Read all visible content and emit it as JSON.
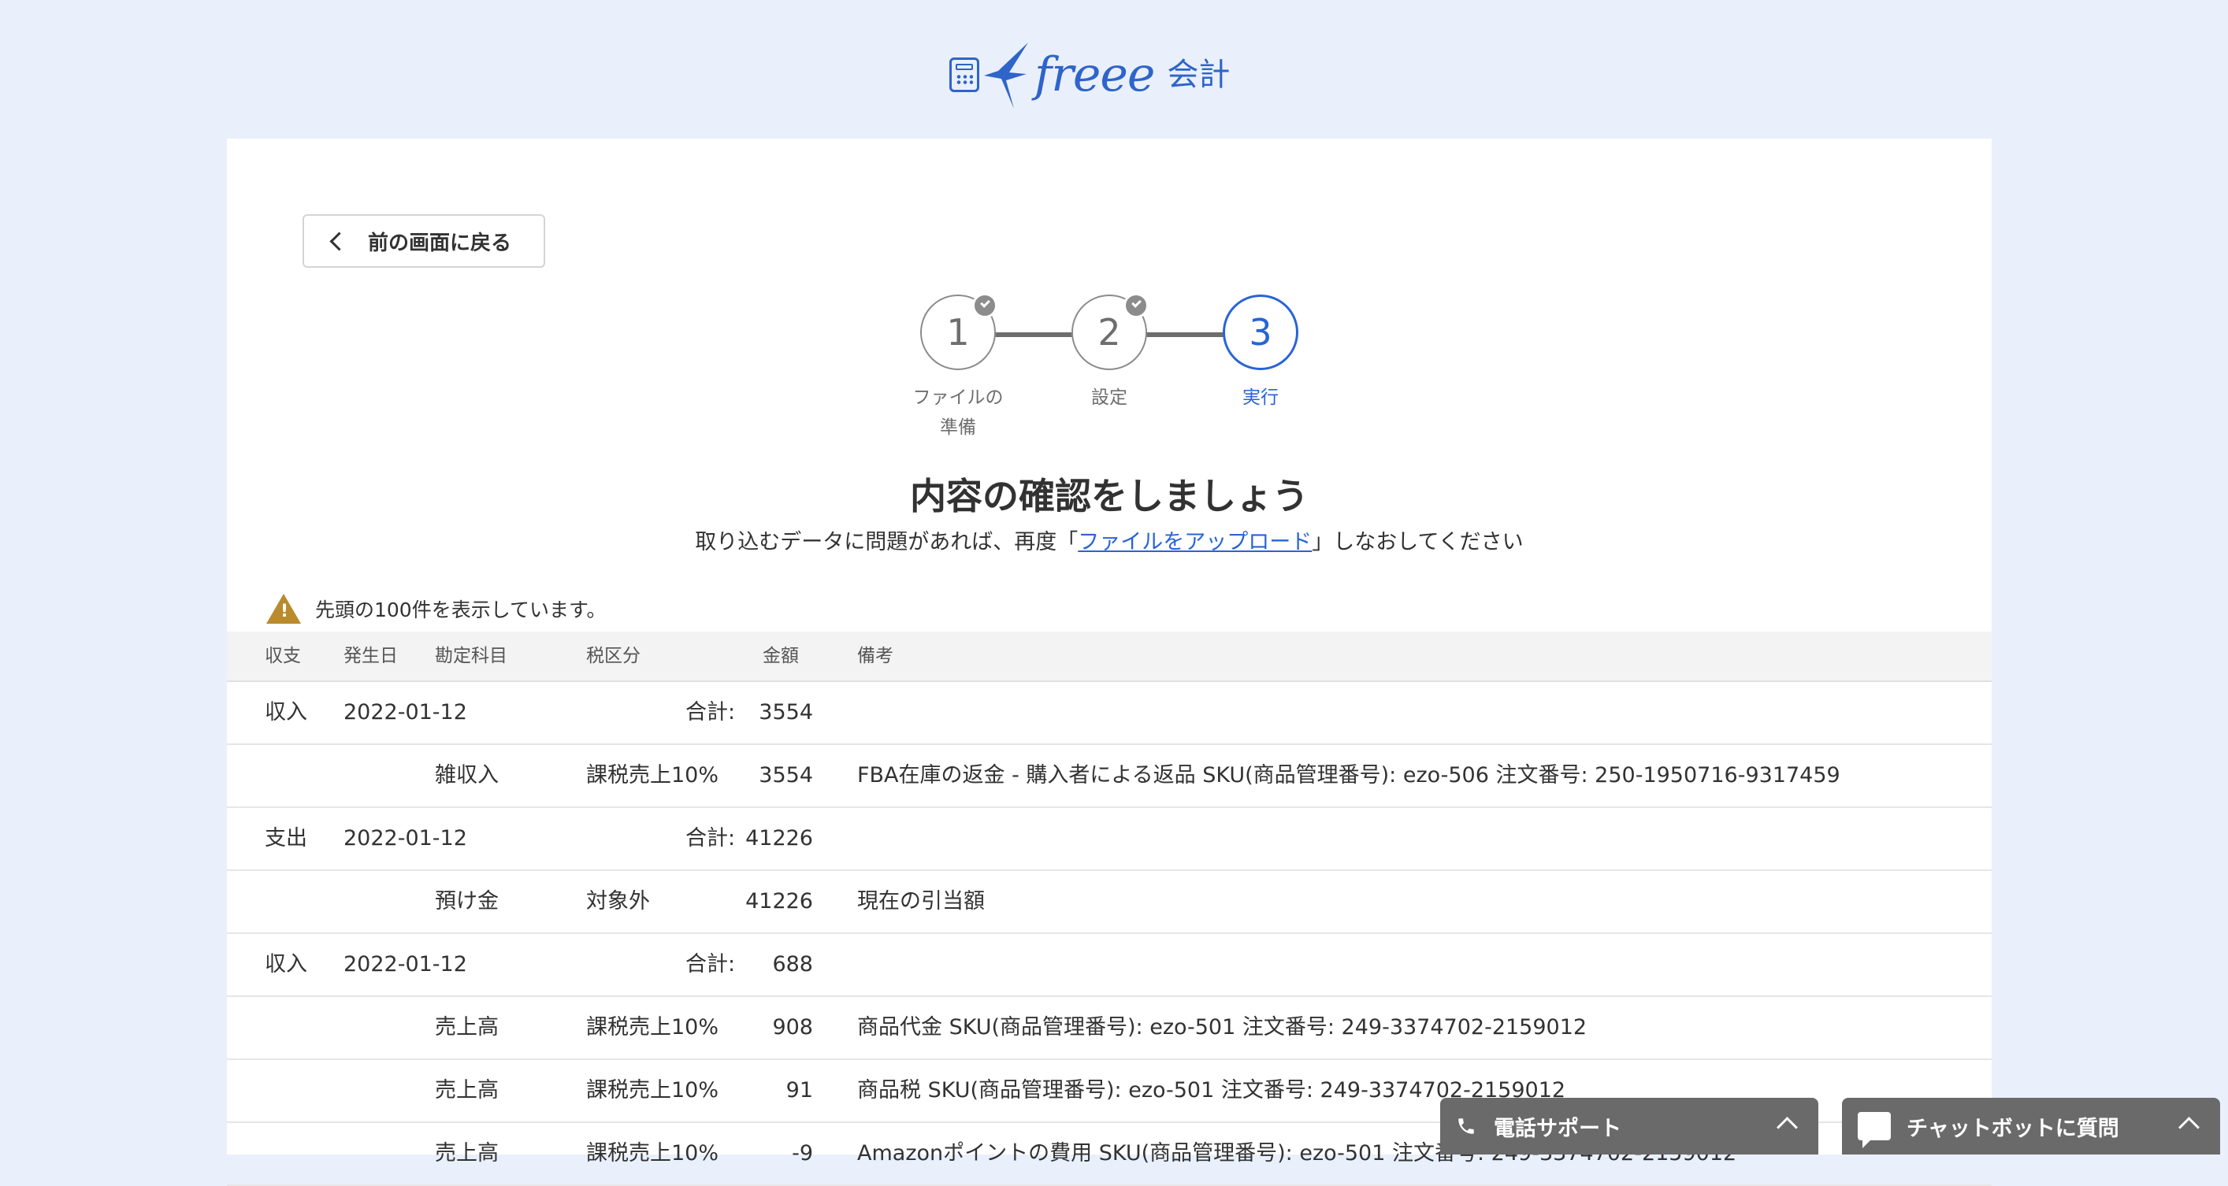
{
  "header": {
    "brand_word": "freee",
    "brand_product": "会計"
  },
  "back_button": {
    "label": "前の画面に戻る"
  },
  "stepper": {
    "steps": [
      {
        "number": "1",
        "label": "ファイルの\n準備",
        "state": "done"
      },
      {
        "number": "2",
        "label": "設定",
        "state": "done"
      },
      {
        "number": "3",
        "label": "実行",
        "state": "active"
      }
    ]
  },
  "content": {
    "title": "内容の確認をしましょう",
    "subtitle_before": "取り込むデータに問題があれば、再度「",
    "subtitle_link": "ファイルをアップロード",
    "subtitle_after": "」しなおしてください",
    "notice": "先頭の100件を表示しています。"
  },
  "table": {
    "headers": {
      "type": "収支",
      "date": "発生日",
      "account": "勘定科目",
      "tax": "税区分",
      "amount": "金額",
      "memo": "備考"
    },
    "total_label": "合計:",
    "rows": [
      {
        "kind": "summary",
        "type": "収入",
        "date": "2022-01-12",
        "amount": "3554"
      },
      {
        "kind": "detail",
        "account": "雑収入",
        "tax": "課税売上10%",
        "amount": "3554",
        "memo": "FBA在庫の返金 - 購入者による返品 SKU(商品管理番号): ezo-506 注文番号: 250-1950716-9317459"
      },
      {
        "kind": "summary",
        "type": "支出",
        "date": "2022-01-12",
        "amount": "41226"
      },
      {
        "kind": "detail",
        "account": "預け金",
        "tax": "対象外",
        "amount": "41226",
        "memo": "現在の引当額"
      },
      {
        "kind": "summary",
        "type": "収入",
        "date": "2022-01-12",
        "amount": "688"
      },
      {
        "kind": "detail",
        "account": "売上高",
        "tax": "課税売上10%",
        "amount": "908",
        "memo": "商品代金 SKU(商品管理番号): ezo-501 注文番号: 249-3374702-2159012"
      },
      {
        "kind": "detail",
        "account": "売上高",
        "tax": "課税売上10%",
        "amount": "91",
        "memo": "商品税 SKU(商品管理番号): ezo-501 注文番号: 249-3374702-2159012"
      },
      {
        "kind": "detail",
        "account": "売上高",
        "tax": "課税売上10%",
        "amount": "-9",
        "memo": "Amazonポイントの費用 SKU(商品管理番号): ezo-501 注文番号: 249-3374702-2159012"
      }
    ]
  },
  "widgets": {
    "phone_support": "電話サポート",
    "chatbot": "チャットボットに質問"
  },
  "colors": {
    "accent": "#2864d7",
    "background": "#e9f0fc",
    "brand": "#2f64c9",
    "warning": "#b98b2c"
  }
}
